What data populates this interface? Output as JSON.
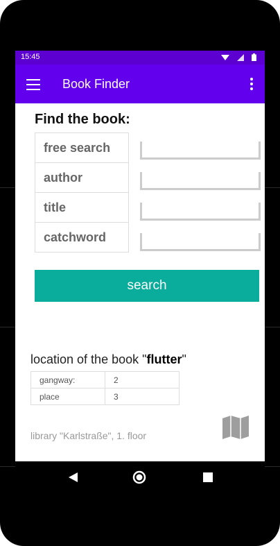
{
  "status": {
    "time": "15:45"
  },
  "appbar": {
    "title": "Book Finder"
  },
  "form": {
    "heading": "Find the book:",
    "fields": [
      {
        "label": "free search",
        "value": ""
      },
      {
        "label": "author",
        "value": ""
      },
      {
        "label": "title",
        "value": ""
      },
      {
        "label": "catchword",
        "value": ""
      }
    ],
    "search_label": "search"
  },
  "result": {
    "title_prefix": "location of the book \"",
    "book": "flutter",
    "title_suffix": "\"",
    "rows": [
      {
        "key": "gangway:",
        "value": "2"
      },
      {
        "key": "place",
        "value": "3"
      }
    ],
    "library": "library \"Karlstraße\", 1. floor"
  },
  "colors": {
    "appbar": "#6200ee",
    "statusbar": "#5c00d2",
    "accent_button": "#0aac9b"
  },
  "icons": [
    "menu-icon",
    "more-vert-icon",
    "wifi-icon",
    "signal-icon",
    "battery-icon",
    "map-icon",
    "back-icon",
    "home-icon",
    "recents-icon"
  ]
}
